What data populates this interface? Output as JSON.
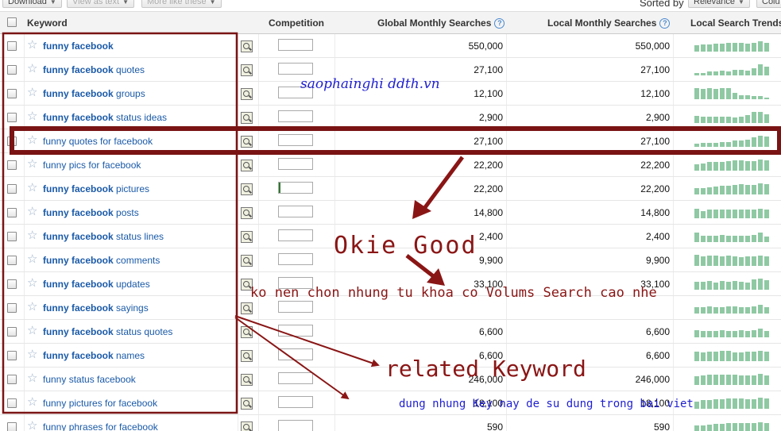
{
  "toolbar": {
    "download_label": "Download",
    "view_as_text_label": "View as text",
    "more_like_these_label": "More like these",
    "sorted_by_label": "Sorted by",
    "relevance_label": "Relevance",
    "columns_label": "Colu"
  },
  "header": {
    "keyword": "Keyword",
    "competition": "Competition",
    "global": "Global Monthly Searches",
    "local": "Local Monthly Searches",
    "trends": "Local Search Trends"
  },
  "rows": [
    {
      "bold": "funny facebook",
      "rest": "",
      "competition": 0.0,
      "global": "550,000",
      "local": "550,000",
      "trend": [
        0.55,
        0.6,
        0.6,
        0.65,
        0.65,
        0.7,
        0.7,
        0.7,
        0.65,
        0.75,
        0.85,
        0.7
      ]
    },
    {
      "bold": "funny facebook",
      "rest": " quotes",
      "competition": 0.0,
      "global": "27,100",
      "local": "27,100",
      "trend": [
        0.2,
        0.2,
        0.3,
        0.3,
        0.4,
        0.35,
        0.45,
        0.45,
        0.4,
        0.6,
        0.95,
        0.7
      ]
    },
    {
      "bold": "funny facebook",
      "rest": " groups",
      "competition": 0.0,
      "global": "12,100",
      "local": "12,100",
      "trend": [
        0.9,
        0.85,
        0.9,
        0.85,
        0.95,
        0.9,
        0.5,
        0.3,
        0.3,
        0.25,
        0.25,
        0.15
      ]
    },
    {
      "bold": "funny facebook",
      "rest": " status ideas",
      "competition": 0.0,
      "global": "2,900",
      "local": "2,900",
      "trend": [
        0.6,
        0.5,
        0.55,
        0.5,
        0.55,
        0.5,
        0.45,
        0.5,
        0.65,
        0.9,
        0.95,
        0.7
      ]
    },
    {
      "bold": "",
      "rest": "funny quotes for facebook",
      "competition": 0.0,
      "global": "27,100",
      "local": "27,100",
      "trend": [
        0.25,
        0.3,
        0.3,
        0.35,
        0.4,
        0.4,
        0.5,
        0.55,
        0.6,
        0.8,
        0.95,
        0.85
      ]
    },
    {
      "bold": "",
      "rest": "funny pics for facebook",
      "competition": 0.0,
      "global": "22,200",
      "local": "22,200",
      "trend": [
        0.55,
        0.6,
        0.7,
        0.75,
        0.75,
        0.8,
        0.85,
        0.85,
        0.8,
        0.8,
        0.95,
        0.85
      ]
    },
    {
      "bold": "funny facebook",
      "rest": " pictures",
      "competition": 0.05,
      "global": "22,200",
      "local": "22,200",
      "trend": [
        0.5,
        0.55,
        0.6,
        0.65,
        0.7,
        0.75,
        0.8,
        0.85,
        0.8,
        0.8,
        0.95,
        0.85
      ]
    },
    {
      "bold": "funny facebook",
      "rest": " posts",
      "competition": 0.0,
      "global": "14,800",
      "local": "14,800",
      "trend": [
        0.8,
        0.6,
        0.7,
        0.75,
        0.7,
        0.75,
        0.7,
        0.75,
        0.7,
        0.75,
        0.8,
        0.7
      ]
    },
    {
      "bold": "funny facebook",
      "rest": " status lines",
      "competition": 0.0,
      "global": "2,400",
      "local": "2,400",
      "trend": [
        0.8,
        0.5,
        0.55,
        0.55,
        0.6,
        0.5,
        0.5,
        0.5,
        0.55,
        0.6,
        0.8,
        0.45
      ]
    },
    {
      "bold": "funny facebook",
      "rest": " comments",
      "competition": 0.0,
      "global": "9,900",
      "local": "9,900",
      "trend": [
        0.9,
        0.8,
        0.85,
        0.85,
        0.8,
        0.85,
        0.8,
        0.75,
        0.8,
        0.8,
        0.85,
        0.8
      ]
    },
    {
      "bold": "funny facebook",
      "rest": " updates",
      "competition": 0.0,
      "global": "33,100",
      "local": "33,100",
      "trend": [
        0.65,
        0.65,
        0.7,
        0.6,
        0.7,
        0.65,
        0.7,
        0.65,
        0.6,
        0.85,
        0.9,
        0.8
      ]
    },
    {
      "bold": "funny facebook",
      "rest": " sayings",
      "competition": 0.0,
      "global": "",
      "local": "",
      "trend": [
        0.5,
        0.55,
        0.6,
        0.55,
        0.5,
        0.6,
        0.6,
        0.55,
        0.5,
        0.6,
        0.7,
        0.5
      ]
    },
    {
      "bold": "funny facebook",
      "rest": " status quotes",
      "competition": 0.0,
      "global": "6,600",
      "local": "6,600",
      "trend": [
        0.6,
        0.5,
        0.55,
        0.55,
        0.6,
        0.55,
        0.55,
        0.6,
        0.55,
        0.6,
        0.75,
        0.55
      ]
    },
    {
      "bold": "funny facebook",
      "rest": " names",
      "competition": 0.0,
      "global": "6,600",
      "local": "6,600",
      "trend": [
        0.8,
        0.75,
        0.8,
        0.8,
        0.85,
        0.85,
        0.75,
        0.75,
        0.8,
        0.8,
        0.85,
        0.8
      ]
    },
    {
      "bold": "",
      "rest": "funny status facebook",
      "competition": 0.0,
      "global": "246,000",
      "local": "246,000",
      "trend": [
        0.75,
        0.8,
        0.85,
        0.85,
        0.85,
        0.85,
        0.85,
        0.8,
        0.8,
        0.8,
        0.9,
        0.8
      ]
    },
    {
      "bold": "",
      "rest": "funny pictures for facebook",
      "competition": 0.0,
      "global": "18,100",
      "local": "18,100",
      "trend": [
        0.6,
        0.7,
        0.75,
        0.8,
        0.8,
        0.85,
        0.85,
        0.85,
        0.8,
        0.8,
        0.9,
        0.85
      ]
    },
    {
      "bold": "",
      "rest": "funny phrases for facebook",
      "competition": 0.0,
      "global": "590",
      "local": "590",
      "trend": [
        0.6,
        0.6,
        0.65,
        0.7,
        0.75,
        0.8,
        0.8,
        0.8,
        0.8,
        0.8,
        0.85,
        0.8
      ]
    }
  ],
  "annotations": {
    "site": "saophainghi ddth.vn",
    "okie": "Okie Good",
    "ko_nen": "ko nen chon nhung tu khoa co Volums Search cao nhe",
    "related": "related Keyword",
    "dung": "dung nhung Key nay de su dung trong bai viet"
  },
  "colors": {
    "link": "#1a5aa8",
    "trend_bar": "#8fc9a3",
    "annotation_red": "#8a1515",
    "annotation_blue": "#1f1fd0",
    "competition_fill": "#2e7a2e"
  }
}
